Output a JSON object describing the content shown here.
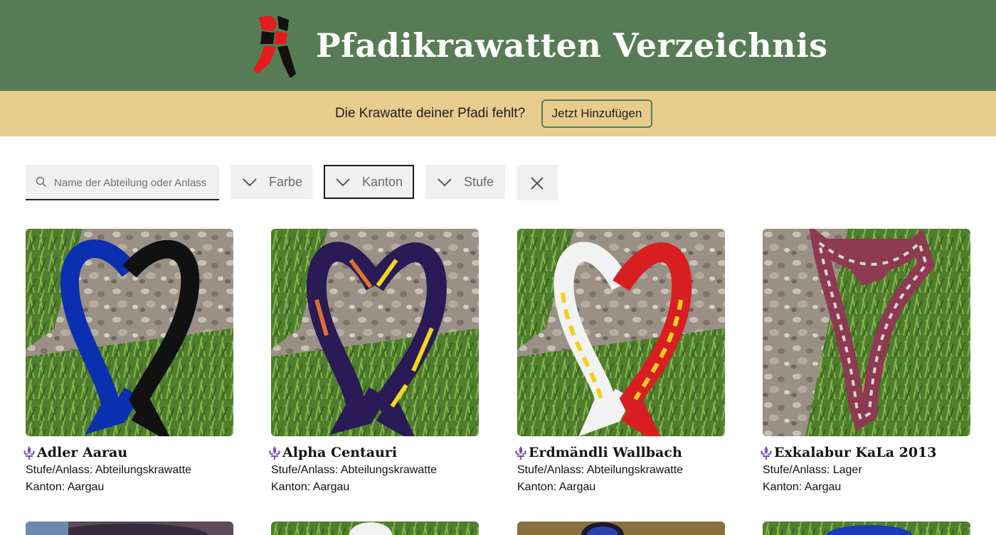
{
  "header": {
    "title": "Pfadikrawatten Verzeichnis",
    "logo_icon": "scout-scarf-logo-icon",
    "background": "#577c55"
  },
  "banner": {
    "text": "Die Krawatte deiner Pfadi fehlt?",
    "button_label": "Jetzt Hinzufügen",
    "background": "#e8cc8e"
  },
  "filters": {
    "search_placeholder": "Name der Abteilung oder Anlass",
    "farbe_label": "Farbe",
    "kanton_label": "Kanton",
    "stufe_label": "Stufe",
    "clear_icon": "close-icon"
  },
  "labels": {
    "stufe": "Stufe/Anlass:",
    "kanton": "Kanton:"
  },
  "cards": [
    {
      "name": "Adler Aarau",
      "stufe": "Abteilungskrawatte",
      "kanton": "Aargau",
      "colors": [
        "#0a2fb0",
        "#111111"
      ]
    },
    {
      "name": "Alpha Centauri",
      "stufe": "Abteilungskrawatte",
      "kanton": "Aargau",
      "colors": [
        "#2a1a55",
        "#e0702a",
        "#f2d81a"
      ]
    },
    {
      "name": "Erdmändli Wallbach",
      "stufe": "Abteilungskrawatte",
      "kanton": "Aargau",
      "colors": [
        "#f2f2f2",
        "#d81e20",
        "#f2d01a"
      ]
    },
    {
      "name": "Exkalabur KaLa 2013",
      "stufe": "Lager",
      "kanton": "Aargau",
      "colors": [
        "#8e3a52",
        "#d8d8d0"
      ]
    }
  ],
  "accent_purple": "#7b4fc0"
}
